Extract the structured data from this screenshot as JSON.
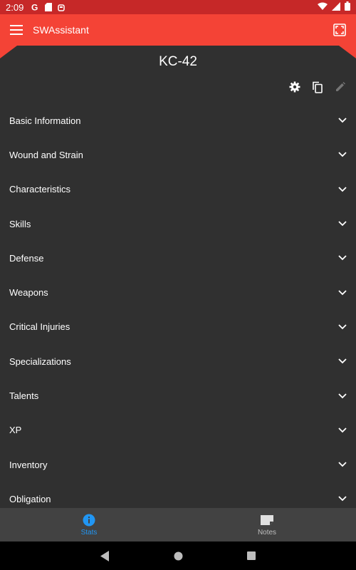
{
  "status_bar": {
    "time": "2:09",
    "icons": [
      "google-icon",
      "sd-card-icon",
      "android-icon",
      "wifi-icon",
      "cellular-icon",
      "battery-icon"
    ]
  },
  "app_bar": {
    "title": "SWAssistant",
    "menu_icon": "hamburger-menu-icon",
    "action_icon": "fullscreen-icon"
  },
  "character": {
    "name": "KC-42"
  },
  "tools": {
    "icons": [
      "settings-icon",
      "copy-icon",
      "edit-icon"
    ]
  },
  "sections": [
    {
      "label": "Basic Information"
    },
    {
      "label": "Wound and Strain"
    },
    {
      "label": "Characteristics"
    },
    {
      "label": "Skills"
    },
    {
      "label": "Defense"
    },
    {
      "label": "Weapons"
    },
    {
      "label": "Critical Injuries"
    },
    {
      "label": "Specializations"
    },
    {
      "label": "Talents"
    },
    {
      "label": "XP"
    },
    {
      "label": "Inventory"
    },
    {
      "label": "Obligation"
    }
  ],
  "bottom_nav": {
    "items": [
      {
        "label": "Stats",
        "icon": "info-icon",
        "active": true
      },
      {
        "label": "Notes",
        "icon": "note-icon",
        "active": false
      }
    ]
  },
  "colors": {
    "app_bar": "#f44336",
    "status_bar": "#c62828",
    "background": "#303030",
    "bottom_nav": "#424242",
    "active": "#2196f3"
  }
}
